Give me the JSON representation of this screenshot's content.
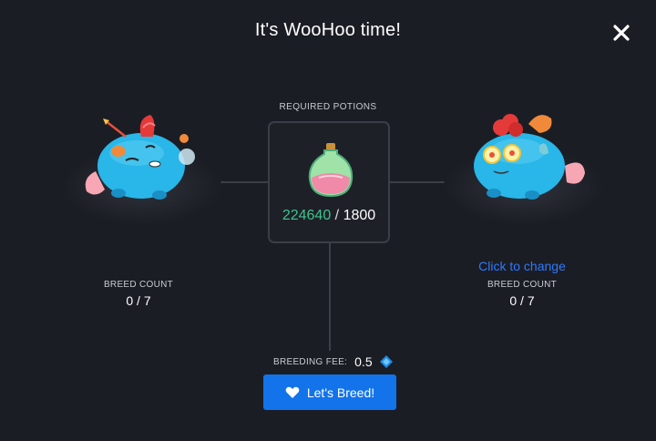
{
  "modal": {
    "title": "It's WooHoo time!",
    "close_icon": "close-icon"
  },
  "potions": {
    "label": "REQUIRED POTIONS",
    "have": "224640",
    "separator": "/",
    "need": "1800",
    "have_color": "#3cc48b",
    "icon": "potion-flask-icon"
  },
  "left_axie": {
    "breed_count_label": "BREED COUNT",
    "breed_count": "0 / 7",
    "body_color": "#29b6e8"
  },
  "right_axie": {
    "change_link": "Click to change",
    "breed_count_label": "BREED COUNT",
    "breed_count": "0 / 7",
    "body_color": "#29b6e8"
  },
  "fee": {
    "label": "BREEDING FEE:",
    "value": "0.5",
    "icon": "axs-token-icon"
  },
  "breed_button": {
    "label": "Let's Breed!",
    "icon": "heart-icon",
    "color": "#1273ea"
  }
}
